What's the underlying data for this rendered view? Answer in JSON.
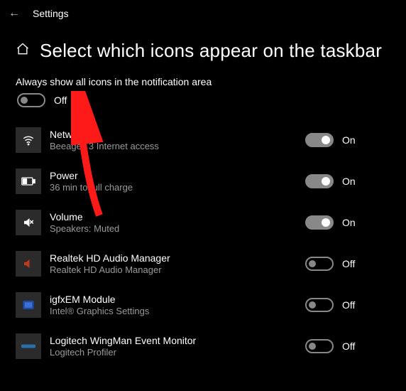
{
  "topbar": {
    "settings_label": "Settings"
  },
  "page": {
    "title": "Select which icons appear on the taskbar"
  },
  "master": {
    "label": "Always show all icons in the notification area",
    "state_label": "Off"
  },
  "state_labels": {
    "on": "On",
    "off": "Off"
  },
  "items": [
    {
      "title": "Network",
      "sub": "Beeagey 3 Internet access",
      "on": true,
      "icon": "wifi"
    },
    {
      "title": "Power",
      "sub": "36 min to full charge",
      "on": true,
      "icon": "battery"
    },
    {
      "title": "Volume",
      "sub": "Speakers: Muted",
      "on": true,
      "icon": "volume-mute"
    },
    {
      "title": "Realtek HD Audio Manager",
      "sub": "Realtek HD Audio Manager",
      "on": false,
      "icon": "realtek"
    },
    {
      "title": "igfxEM Module",
      "sub": "Intel® Graphics Settings",
      "on": false,
      "icon": "intel"
    },
    {
      "title": "Logitech WingMan Event Monitor",
      "sub": "Logitech Profiler",
      "on": false,
      "icon": "logitech"
    }
  ]
}
